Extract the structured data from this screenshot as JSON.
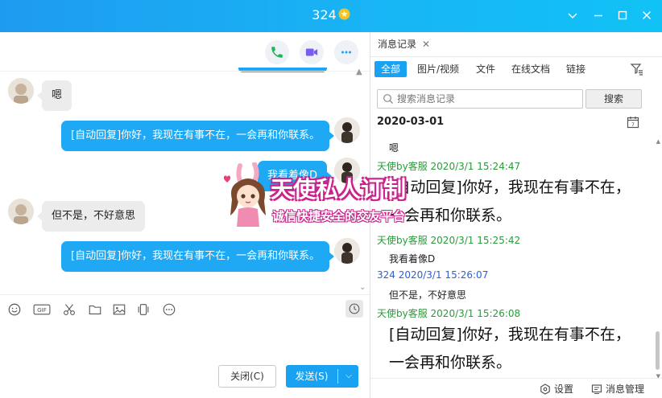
{
  "window": {
    "title": "324"
  },
  "chat": {
    "messages": [
      {
        "side": "in",
        "text": "嗯"
      },
      {
        "side": "out",
        "text": "[自动回复]你好，我现在有事不在，一会再和你联系。"
      },
      {
        "side": "out",
        "text": "我看着像D"
      },
      {
        "side": "in",
        "text": "但不是，不好意思"
      },
      {
        "side": "out",
        "text": "[自动回复]你好，我现在有事不在，一会再和你联系。"
      }
    ]
  },
  "composer": {
    "close_label": "关闭(C)",
    "send_label": "发送(S)"
  },
  "history": {
    "tab_label": "消息记录",
    "filters": [
      "全部",
      "图片/视频",
      "文件",
      "在线文档",
      "链接"
    ],
    "search_placeholder": "搜索消息记录",
    "search_button": "搜索",
    "date": "2020-03-01",
    "entries": [
      {
        "meta": "",
        "text": "嗯"
      },
      {
        "meta": "天使by客服 2020/3/1 15:24:47",
        "text": "[自动回复]你好，我现在有事不在，"
      },
      {
        "meta": "",
        "text": "一会再和你联系。"
      },
      {
        "meta": "天使by客服 2020/3/1 15:25:42",
        "text": "我看着像D"
      },
      {
        "meta": "324 2020/3/1 15:26:07",
        "text": "但不是，不好意思"
      },
      {
        "meta": "天使by客服 2020/3/1 15:26:08",
        "text": "[自动回复]你好，我现在有事不在，"
      },
      {
        "meta": "",
        "text": "一会再和你联系。"
      }
    ],
    "footer_settings": "设置",
    "footer_manage": "消息管理"
  },
  "watermark": {
    "title": "天使私人订制",
    "subtitle": "诚信快捷安全的交友平台"
  },
  "colors": {
    "accent": "#1aa2f2",
    "meta_green": "#2a9a3a",
    "meta_blue": "#2b5fd9",
    "watermark_pink": "#c9228a"
  }
}
